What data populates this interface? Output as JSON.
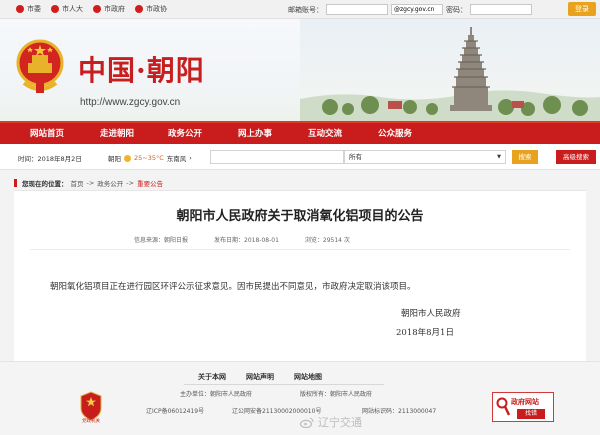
{
  "topbar": {
    "links": [
      "市委",
      "市人大",
      "市政府",
      "市政协"
    ],
    "login": {
      "user_label": "邮箱账号：",
      "user_placeholder": "",
      "domain_value": "@zgcy.gov.cn",
      "password_label": "密码：",
      "button": "登录"
    }
  },
  "header": {
    "title": "中国·朝阳",
    "url": "http://www.zgcy.gov.cn"
  },
  "nav": {
    "items": [
      "网站首页",
      "走进朝阳",
      "政务公开",
      "网上办事",
      "互动交流",
      "公众服务"
    ]
  },
  "info": {
    "date": "时间：2018年8月2日",
    "weather_city": "朝阳",
    "weather_temp": "25~35°C",
    "weather_wind": "东南风",
    "scope_value": "所有",
    "search_button": "搜索",
    "advanced_button": "高级搜索"
  },
  "breadcrumb": {
    "label": "您现在的位置：",
    "items": [
      "首页",
      "政务公开",
      "重要公告"
    ]
  },
  "article": {
    "title": "朝阳市人民政府关于取消氧化铝项目的公告",
    "meta_source": "信息来源：朝阳日报",
    "meta_date": "发布日期：2018-08-01",
    "meta_views": "浏览：29514 次",
    "body": "朝阳氧化铝项目正在进行园区环评公示征求意见。因市民提出不同意见，市政府决定取消该项目。",
    "signature": "朝阳市人民政府",
    "sign_date": "2018年8月1日"
  },
  "footer": {
    "links": [
      "关于本网",
      "网站声明",
      "网站地图"
    ],
    "sponsor": "主办单位：朝阳市人民政府",
    "copyright": "版权所有：朝阳市人民政府",
    "icp": "辽ICP备06012419号",
    "beian": "辽公网安备21130002000010号",
    "site_id": "网站标识码：2113000047",
    "party_badge": "党政机关",
    "gov_badge_title": "政府网站",
    "gov_badge_action": "找错"
  },
  "watermark": "辽宁交通"
}
